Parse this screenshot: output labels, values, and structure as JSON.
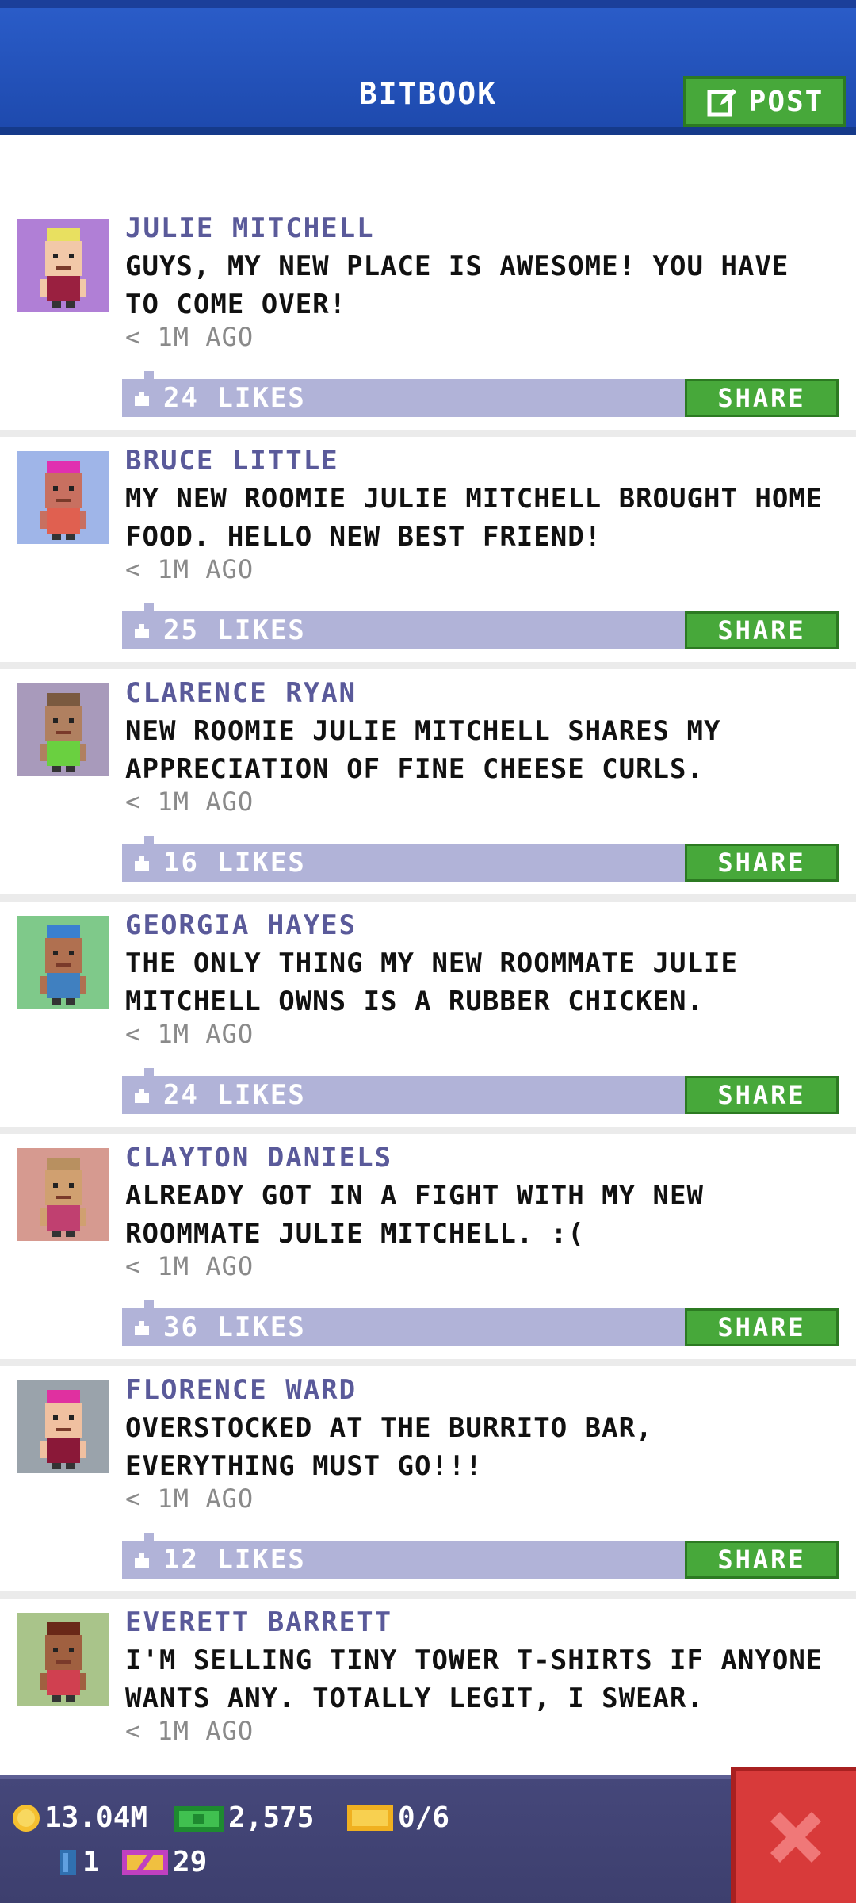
{
  "header": {
    "title": "BITBOOK",
    "post_label": "POST"
  },
  "posts": [
    {
      "author": "JULIE MITCHELL",
      "message": "GUYS, MY NEW PLACE IS AWESOME! YOU HAVE TO COME OVER!",
      "time": "< 1M AGO",
      "likes": "24 LIKES",
      "share_label": "SHARE",
      "avatar_bg": "#b07fd6",
      "skin": "#f2c8a8",
      "hair": "#e8e060",
      "shirt": "#9a2040"
    },
    {
      "author": "BRUCE LITTLE",
      "message": "MY NEW ROOMIE JULIE MITCHELL BROUGHT HOME FOOD. HELLO NEW BEST FRIEND!",
      "time": "< 1M AGO",
      "likes": "25 LIKES",
      "share_label": "SHARE",
      "avatar_bg": "#9fb5e8",
      "skin": "#c87060",
      "hair": "#e030b0",
      "shirt": "#e06050"
    },
    {
      "author": "CLARENCE RYAN",
      "message": "NEW ROOMIE JULIE MITCHELL SHARES MY APPRECIATION OF FINE CHEESE CURLS.",
      "time": "< 1M AGO",
      "likes": "16 LIKES",
      "share_label": "SHARE",
      "avatar_bg": "#a89abb",
      "skin": "#b08060",
      "hair": "#7a5a40",
      "shirt": "#6ad040"
    },
    {
      "author": "GEORGIA HAYES",
      "message": "THE ONLY THING MY NEW ROOMMATE JULIE MITCHELL OWNS IS A RUBBER CHICKEN.",
      "time": "< 1M AGO",
      "likes": "24 LIKES",
      "share_label": "SHARE",
      "avatar_bg": "#7fc98a",
      "skin": "#b07050",
      "hair": "#3a80d0",
      "shirt": "#4080c0"
    },
    {
      "author": "CLAYTON DANIELS",
      "message": "ALREADY GOT IN A FIGHT WITH MY NEW ROOMMATE JULIE MITCHELL. :(",
      "time": "< 1M AGO",
      "likes": "36 LIKES",
      "share_label": "SHARE",
      "avatar_bg": "#d69a90",
      "skin": "#d0a070",
      "hair": "#b89060",
      "shirt": "#c04070"
    },
    {
      "author": "FLORENCE WARD",
      "message": "OVERSTOCKED AT THE BURRITO BAR, EVERYTHING MUST GO!!!",
      "time": "< 1M AGO",
      "likes": "12 LIKES",
      "share_label": "SHARE",
      "avatar_bg": "#9aa3ab",
      "skin": "#f0c0a0",
      "hair": "#e030a0",
      "shirt": "#8a1838"
    },
    {
      "author": "EVERETT BARRETT",
      "message": "I'M SELLING TINY TOWER T-SHIRTS IF ANYONE WANTS ANY. TOTALLY LEGIT, I SWEAR.",
      "time": "< 1M AGO",
      "likes": "",
      "share_label": "",
      "avatar_bg": "#a9c48a",
      "skin": "#a06040",
      "hair": "#6a2818",
      "shirt": "#d04050"
    }
  ],
  "status_bar": {
    "coins": "13.04M",
    "bux": "2,575",
    "tickets": "0/6",
    "keys": "1",
    "level": "29"
  },
  "colors": {
    "header_blue": "#1e4aae",
    "share_green": "#47a83a",
    "likes_bar": "#b1b3d8",
    "author_purple": "#5a5a9a",
    "close_red": "#d83a3a"
  },
  "icons": [
    "edit-icon",
    "thumbs-up-icon",
    "coin-icon",
    "bux-icon",
    "ticket-icon",
    "key-icon",
    "level-icon",
    "close-icon"
  ]
}
